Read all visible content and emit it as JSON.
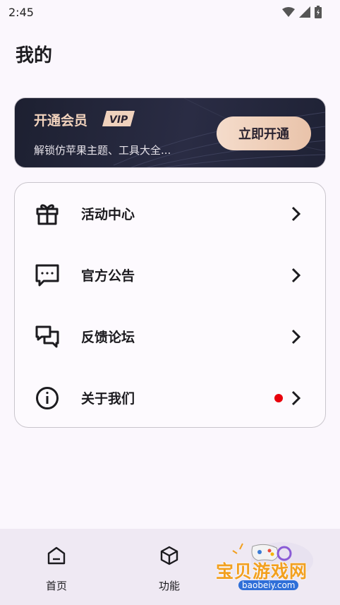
{
  "status_bar": {
    "time": "2:45",
    "icons": [
      "wifi-icon",
      "signal-icon",
      "battery-icon"
    ]
  },
  "page": {
    "title": "我的"
  },
  "vip": {
    "title": "开通会员",
    "badge": "VIP",
    "subtitle": "解锁仿苹果主题、工具大全...",
    "button_label": "立即开通",
    "colors": {
      "card_bg": "#1d2031",
      "title": "#f2d3bd",
      "button": "#f0d2bd"
    }
  },
  "menu": {
    "items": [
      {
        "label": "活动中心",
        "icon": "gift-icon"
      },
      {
        "label": "官方公告",
        "icon": "message-dots-icon"
      },
      {
        "label": "反馈论坛",
        "icon": "forum-icon"
      },
      {
        "label": "关于我们",
        "icon": "info-icon",
        "badge": "red-dot"
      }
    ]
  },
  "bottom_nav": {
    "items": [
      {
        "label": "首页",
        "icon": "home-icon"
      },
      {
        "label": "功能",
        "icon": "cube-icon"
      }
    ]
  },
  "watermark": {
    "text": "宝贝游戏网",
    "url": "baobeiy.com"
  }
}
